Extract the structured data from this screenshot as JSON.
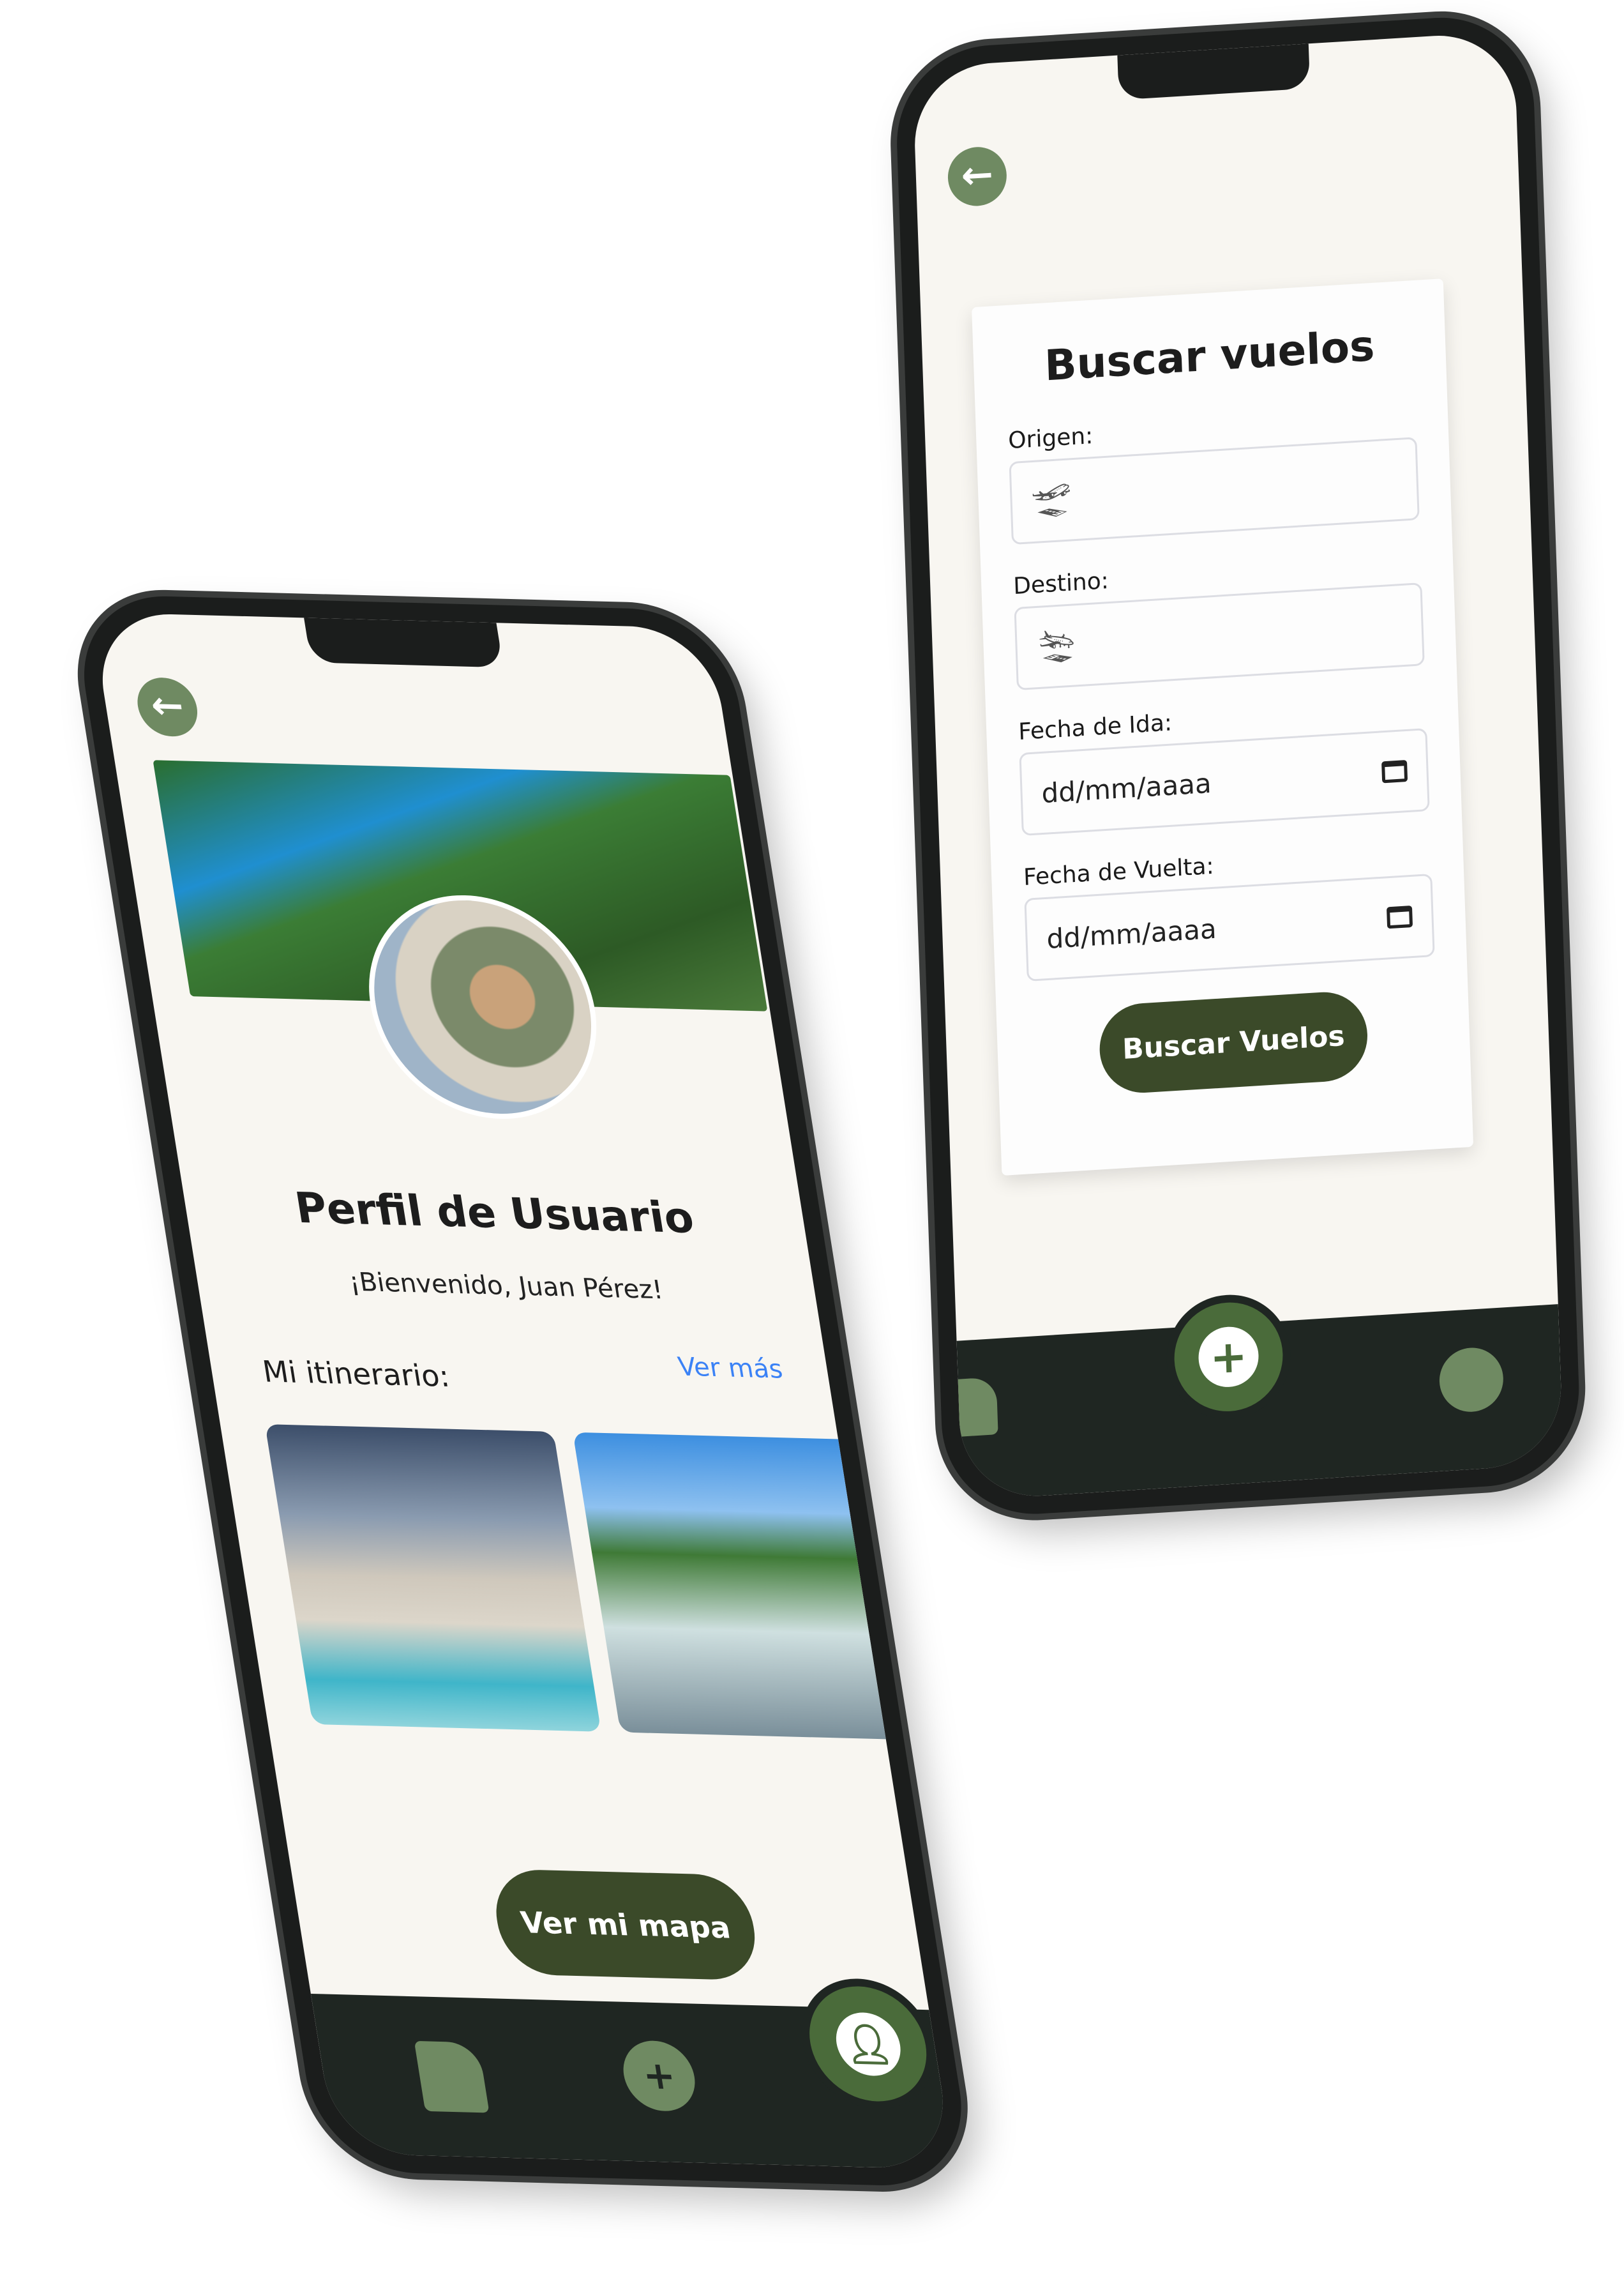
{
  "flight_screen": {
    "title": "Buscar vuelos",
    "fields": [
      {
        "label": "Origen:",
        "value": "",
        "icon": "plane-departure-icon"
      },
      {
        "label": "Destino:",
        "value": "",
        "icon": "plane-arrival-icon"
      },
      {
        "label": "Fecha de Ida:",
        "placeholder": "dd/mm/aaaa",
        "icon": "calendar-icon"
      },
      {
        "label": "Fecha de Vuelta:",
        "placeholder": "dd/mm/aaaa",
        "icon": "calendar-icon"
      }
    ],
    "submit_label": "Buscar Vuelos",
    "nav": [
      "home-icon",
      "plus-icon",
      "profile-icon"
    ]
  },
  "profile_screen": {
    "title": "Perfil de Usuario",
    "welcome": "¡Bienvenido, Juan Pérez!",
    "itinerary_label": "Mi itinerario:",
    "see_more": "Ver más",
    "map_button": "Ver mi mapa",
    "nav": [
      "home-icon",
      "plus-icon",
      "profile-icon"
    ]
  },
  "colors": {
    "primary": "#3b4a29",
    "accent": "#4a6b3a",
    "muted": "#6f8a62",
    "background": "#f8f6f1",
    "nav": "#1f2622",
    "link": "#3b82f6"
  }
}
